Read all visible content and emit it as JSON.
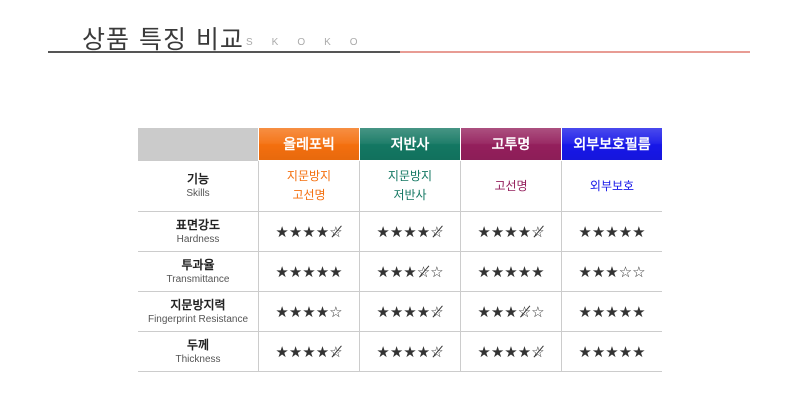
{
  "header": {
    "title": "상품 특징 비교",
    "brand": "SKOKO"
  },
  "colors": {
    "oleophobic": "#f46f0e",
    "antiglare": "#137762",
    "glossy": "#941f5c",
    "exterior": "#1717e8",
    "corner": "#cbcbcb"
  },
  "table": {
    "products": [
      "올레포빅",
      "저반사",
      "고투명",
      "외부보호필름"
    ],
    "skills": {
      "label_ko": "기능",
      "label_en": "Skills",
      "values": [
        [
          "지문방지",
          "고선명"
        ],
        [
          "지문방지",
          "저반사"
        ],
        [
          "고선명"
        ],
        [
          "외부보호"
        ]
      ]
    },
    "ratings": [
      {
        "label_ko": "표면강도",
        "label_en": "Hardness",
        "stars": [
          "★★★★☆̸",
          "★★★★☆̸",
          "★★★★☆̸",
          "★★★★★"
        ]
      },
      {
        "label_ko": "투과율",
        "label_en": "Transmittance",
        "stars": [
          "★★★★★",
          "★★★☆̸☆",
          "★★★★★",
          "★★★☆☆"
        ]
      },
      {
        "label_ko": "지문방지력",
        "label_en": "Fingerprint Resistance",
        "stars": [
          "★★★★☆",
          "★★★★☆̸",
          "★★★☆̸☆",
          "★★★★★"
        ]
      },
      {
        "label_ko": "두께",
        "label_en": "Thickness",
        "stars": [
          "★★★★☆̸",
          "★★★★☆̸",
          "★★★★☆̸",
          "★★★★★"
        ]
      }
    ]
  }
}
